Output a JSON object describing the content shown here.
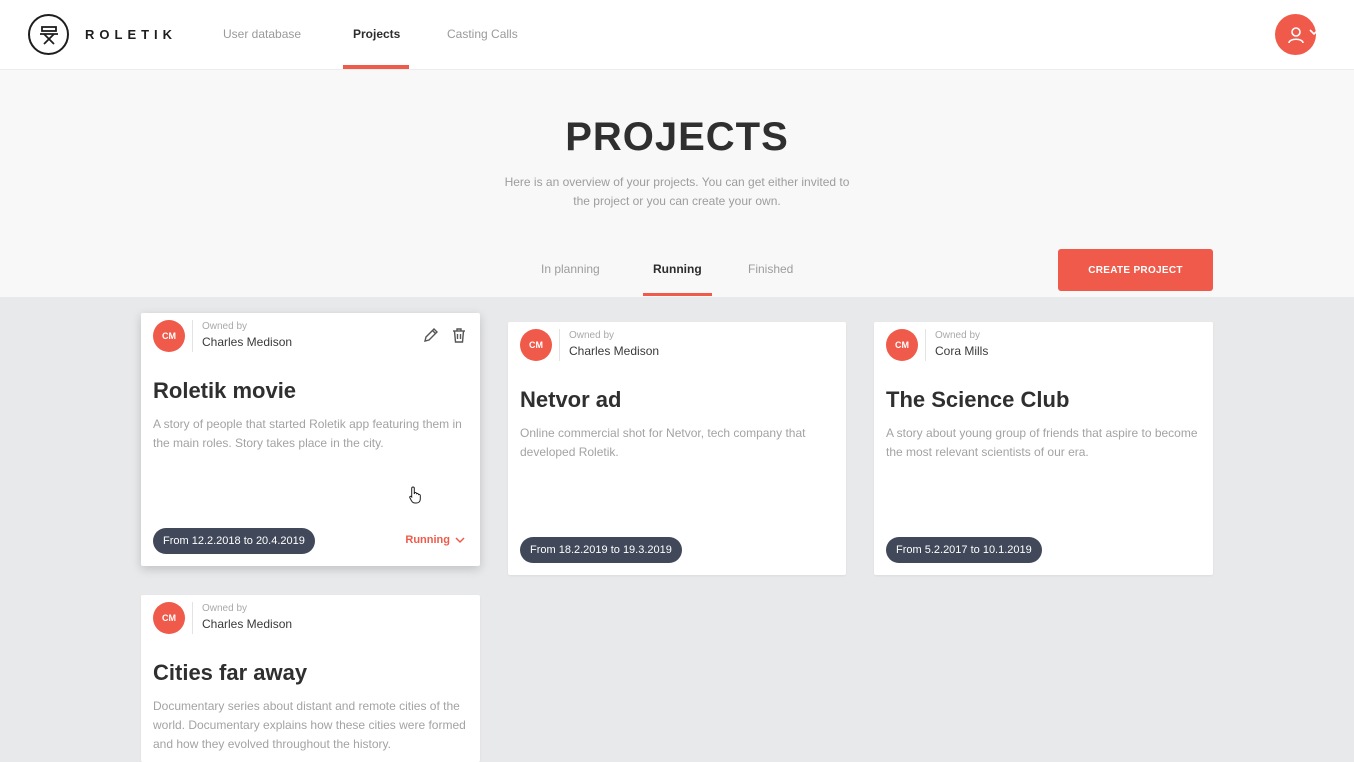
{
  "app": {
    "brand": "ROLETIK"
  },
  "nav": {
    "links": [
      "User database",
      "Projects",
      "Casting Calls"
    ],
    "active": "Projects"
  },
  "page": {
    "title": "PROJECTS",
    "subtitle": "Here is an overview of your projects. You can get either invited to the project or you can create your own."
  },
  "tabs": {
    "items": [
      "In planning",
      "Running",
      "Finished"
    ],
    "active": "Running"
  },
  "create_button": "CREATE PROJECT",
  "projects": [
    {
      "initials": "CM",
      "owned_label": "Owned by",
      "owner": "Charles Medison",
      "title": "Roletik movie",
      "description": "A story of people that started Roletik app featuring them in the main roles. Story takes place in the city.",
      "dates": "From 12.2.2018 to 20.4.2019",
      "status": "Running",
      "icons": [
        "pencil-icon",
        "trash-icon"
      ]
    },
    {
      "initials": "CM",
      "owned_label": "Owned by",
      "owner": "Charles Medison",
      "title": "Netvor ad",
      "description": "Online commercial shot for Netvor, tech company that developed Roletik.",
      "dates": "From 18.2.2019 to 19.3.2019"
    },
    {
      "initials": "CM",
      "owned_label": "Owned by",
      "owner": "Cora Mills",
      "title": "The Science Club",
      "description": "A story about young group of friends that aspire to become the most relevant scientists of our era.",
      "dates": "From 5.2.2017 to 10.1.2019"
    },
    {
      "initials": "CM",
      "owned_label": "Owned by",
      "owner": "Charles Medison",
      "title": "Cities far away",
      "description": "Documentary series about distant and remote cities of the world. Documentary explains how these cities were formed and how they evolved throughout the history."
    }
  ],
  "colors": {
    "accent": "#f05a4a",
    "pill": "#404859",
    "background": "#e8e9eb",
    "header": "#f8f8f8"
  }
}
